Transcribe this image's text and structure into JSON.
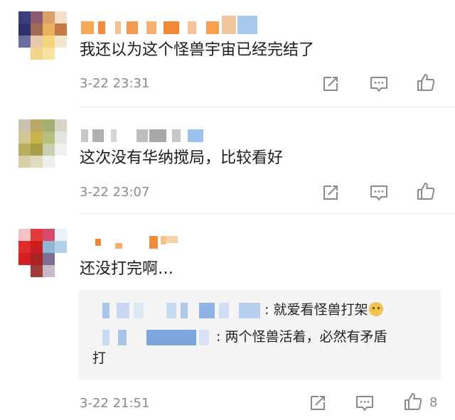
{
  "comments": [
    {
      "text": "我还以为这个怪兽宇宙已经完结了",
      "timestamp": "3-22 23:31",
      "actions": {
        "share": "share-icon",
        "reply": "comment-icon",
        "like": "thumbs-up-icon"
      }
    },
    {
      "text": "这次没有华纳搅局，比较看好",
      "timestamp": "3-22 23:07",
      "actions": {
        "share": "share-icon",
        "reply": "comment-icon",
        "like": "thumbs-up-icon"
      }
    },
    {
      "text": "还没打完啊…",
      "timestamp": "3-22 21:51",
      "like_count": "8",
      "actions": {
        "share": "share-icon",
        "reply": "comment-icon",
        "like": "thumbs-up-icon"
      },
      "replies": [
        {
          "text": ": 就爱看怪兽打架",
          "emoji": "doge-emoji"
        },
        {
          "text": ": 两个怪兽活着，必然有矛盾",
          "continuation": "打"
        }
      ]
    }
  ],
  "colors": {
    "text": "#1c1c1c",
    "meta": "#8a8a8a",
    "reply_bg": "#f5f5f5",
    "icon": "#8a8a8a"
  }
}
